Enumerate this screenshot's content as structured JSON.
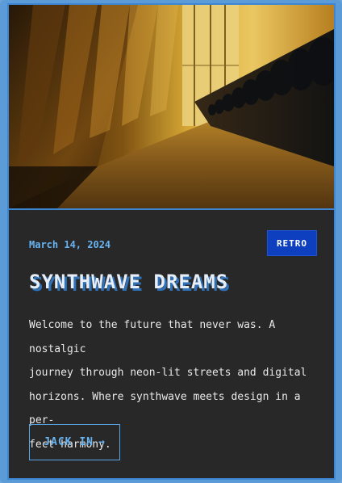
{
  "post": {
    "date": "March 14, 2024",
    "tag": "RETRO",
    "title": "SYNTHWAVE DREAMS",
    "description_lines": [
      "Welcome to the future that never was. A nostalgic",
      "journey through neon-lit streets and digital",
      "horizons. Where synthwave meets design in a per-",
      "fect harmony."
    ],
    "cta_label": "JACK IN",
    "cta_icon": "arrow-right-icon",
    "cta_arrow": "→"
  },
  "colors": {
    "accent": "#68b4f2",
    "badge_bg": "#0d3fbf",
    "card_bg": "#282828",
    "frame": "#5b9bd8"
  }
}
